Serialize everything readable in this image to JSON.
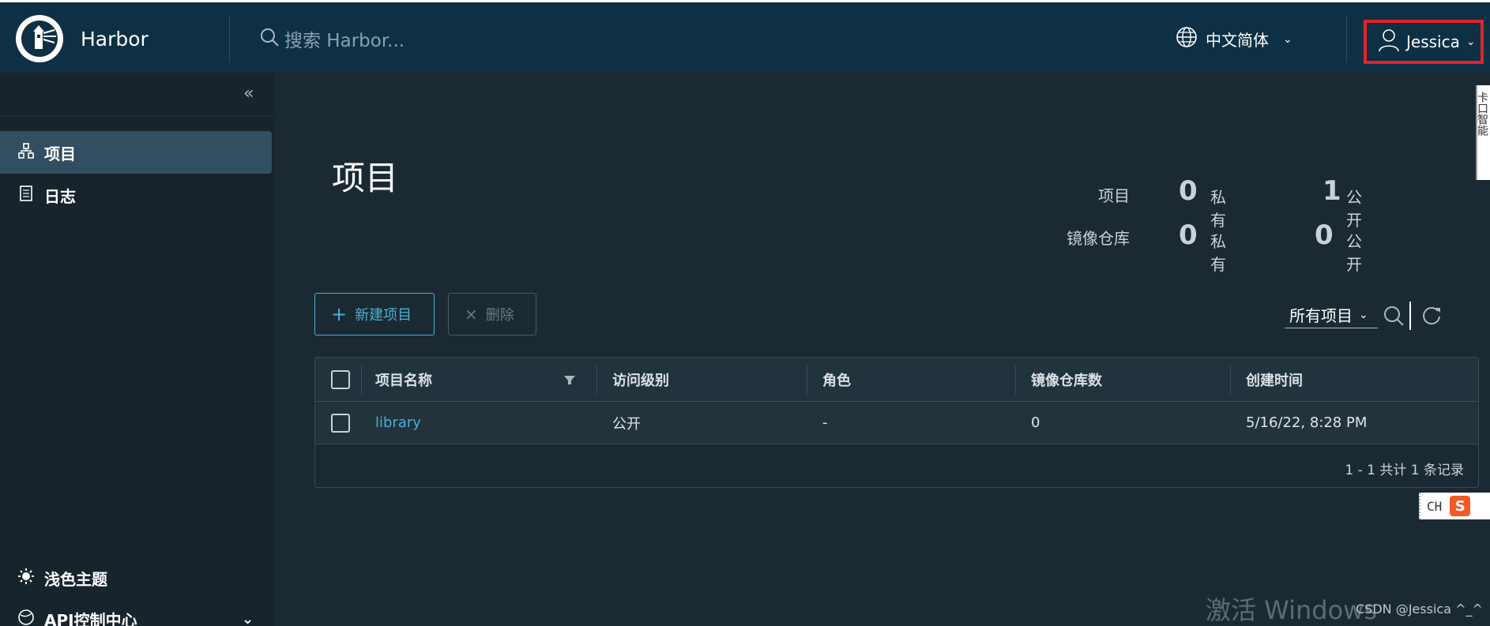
{
  "header": {
    "brand": "Harbor",
    "search_placeholder": "搜索 Harbor...",
    "language": "中文简体",
    "user": "Jessica"
  },
  "sidebar": {
    "items": [
      {
        "label": "项目",
        "icon": "projects-icon",
        "active": true
      },
      {
        "label": "日志",
        "icon": "logs-icon",
        "active": false
      }
    ],
    "bottom": [
      {
        "label": "浅色主题",
        "icon": "sun-icon"
      },
      {
        "label": "API控制中心",
        "icon": "globe-icon"
      }
    ]
  },
  "main": {
    "title": "项目",
    "stats": {
      "projects_label": "项目",
      "repos_label": "镜像仓库",
      "private_label": "私有",
      "public_label": "公开",
      "projects_private": "0",
      "projects_public": "1",
      "repos_private": "0",
      "repos_public": "0"
    },
    "new_button": "新建项目",
    "delete_button": "删除",
    "filter_value": "所有项目",
    "columns": [
      "项目名称",
      "访问级别",
      "角色",
      "镜像仓库数",
      "创建时间"
    ],
    "rows": [
      {
        "name": "library",
        "access": "公开",
        "role": "-",
        "repo_count": "0",
        "created": "5/16/22, 8:28 PM"
      }
    ],
    "footer": "1 - 1 共计 1 条记录"
  },
  "overlays": {
    "side_tab": "卡口智能",
    "ime_text": "CH",
    "ime_logo": "S",
    "watermark": "激活 Windows",
    "csdn": "CSDN @Jessica ^_^"
  },
  "colors": {
    "header_bg": "#0e3044",
    "sidebar_bg": "#17242b",
    "content_bg": "#1b2a32",
    "accent": "#49afd9",
    "highlight_box": "#e2232a"
  }
}
